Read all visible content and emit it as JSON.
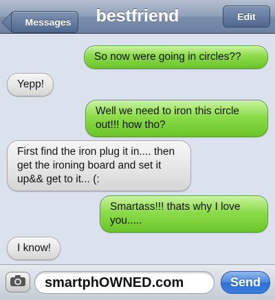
{
  "header": {
    "back_label": "Messages",
    "title": "bestfriend",
    "edit_label": "Edit"
  },
  "messages": [
    {
      "direction": "sent",
      "text": "So now were going in circles??"
    },
    {
      "direction": "received",
      "text": "Yepp!"
    },
    {
      "direction": "sent",
      "text": "Well we need to iron this circle out!!! how tho?"
    },
    {
      "direction": "received",
      "text": "First find the iron plug it in.... then get the ironing board and set it up&& get to it... (:"
    },
    {
      "direction": "sent",
      "text": "Smartass!!! thats why I love you....."
    },
    {
      "direction": "received",
      "text": "I know!"
    }
  ],
  "composer": {
    "text": "smartphOWNED.com",
    "send_label": "Send",
    "camera_icon": "camera-icon"
  },
  "colors": {
    "sent_bubble": "#8cdc4a",
    "received_bubble": "#e4e4e4",
    "send_button": "#3b7ee0",
    "background": "#dbe2ed"
  }
}
